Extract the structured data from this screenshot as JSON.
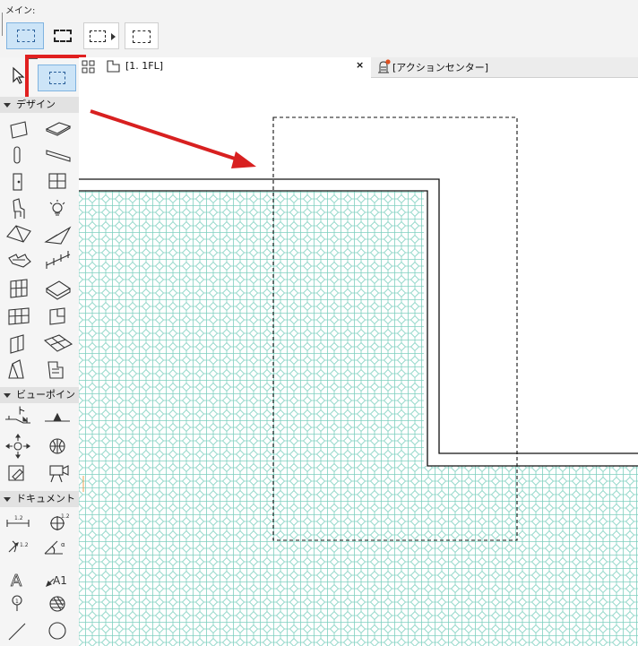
{
  "toolbar": {
    "title": "メイン:"
  },
  "palette": {
    "sections": [
      {
        "label": "デザイン"
      },
      {
        "label": "ビューポイント"
      },
      {
        "label": "ドキュメント"
      }
    ]
  },
  "tabs": [
    {
      "label": "[1. 1FL]"
    },
    {
      "label": "[アクションセンター]"
    }
  ],
  "tab_close_symbol": "×",
  "annotation": {
    "highlight_color": "#e02020",
    "arrow_color": "#d82020"
  },
  "colors": {
    "selection_blue": "#cce4f7",
    "selection_border": "#7fb3e0",
    "hatch": "#7fd0c0"
  },
  "icons": [
    "marquee-rect-icon",
    "marquee-rect-bold-icon",
    "marquee-dropdown-icon",
    "marquee-3d-icon",
    "arrow-select-icon",
    "marquee-tool-icon",
    "grid-view-icon",
    "floorplan-icon",
    "action-center-icon"
  ]
}
